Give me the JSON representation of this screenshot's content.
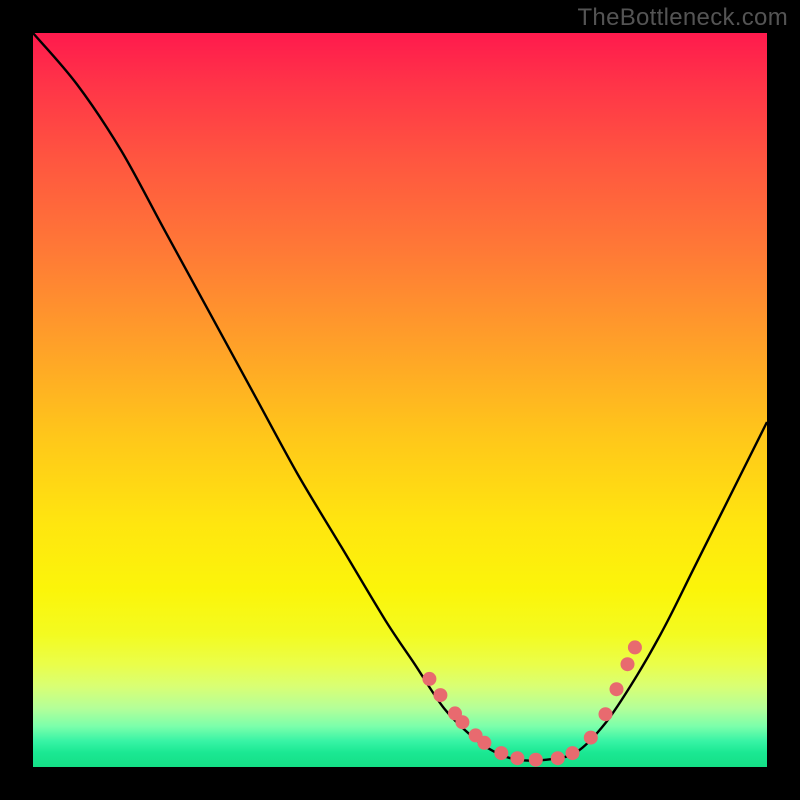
{
  "watermark": "TheBottleneck.com",
  "chart_data": {
    "type": "line",
    "title": "",
    "xlabel": "",
    "ylabel": "",
    "xlim": [
      0,
      1
    ],
    "ylim": [
      0,
      1
    ],
    "grid": false,
    "series": [
      {
        "name": "curve",
        "color": "#000000",
        "x": [
          0.0,
          0.06,
          0.12,
          0.18,
          0.24,
          0.3,
          0.36,
          0.42,
          0.48,
          0.52,
          0.56,
          0.6,
          0.63,
          0.66,
          0.7,
          0.74,
          0.78,
          0.82,
          0.86,
          0.9,
          0.94,
          1.0
        ],
        "y": [
          1.0,
          0.93,
          0.84,
          0.73,
          0.62,
          0.51,
          0.4,
          0.3,
          0.2,
          0.14,
          0.08,
          0.04,
          0.02,
          0.01,
          0.01,
          0.02,
          0.06,
          0.12,
          0.19,
          0.27,
          0.35,
          0.47
        ]
      },
      {
        "name": "markers",
        "color": "#e86a6f",
        "x": [
          0.54,
          0.555,
          0.575,
          0.585,
          0.603,
          0.615,
          0.638,
          0.66,
          0.685,
          0.715,
          0.735,
          0.76,
          0.78,
          0.795,
          0.81,
          0.82
        ],
        "y": [
          0.12,
          0.098,
          0.073,
          0.061,
          0.043,
          0.033,
          0.019,
          0.012,
          0.01,
          0.012,
          0.019,
          0.04,
          0.072,
          0.106,
          0.14,
          0.163
        ]
      }
    ],
    "gradient_stops": [
      {
        "pos": 0.0,
        "color": "#ff1a4d"
      },
      {
        "pos": 0.5,
        "color": "#ffcc15"
      },
      {
        "pos": 0.82,
        "color": "#f3fb21"
      },
      {
        "pos": 1.0,
        "color": "#14df86"
      }
    ]
  }
}
